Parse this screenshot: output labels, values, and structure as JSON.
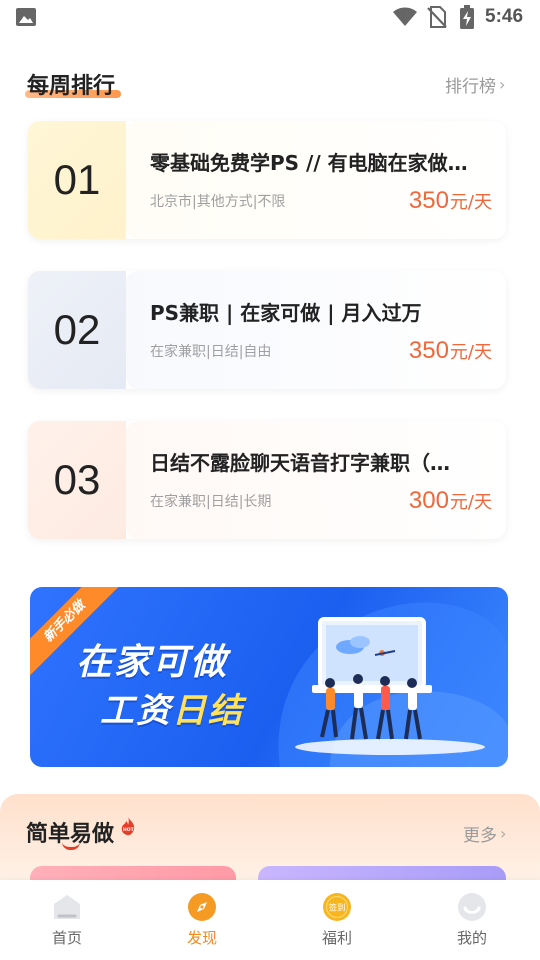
{
  "status_bar": {
    "time": "5:46",
    "icons": [
      "image-icon",
      "wifi-icon",
      "no-sim-icon",
      "battery-charging-icon"
    ]
  },
  "weekly_rank": {
    "title": "每周排行",
    "more_label": "排行榜",
    "items": [
      {
        "rank": "01",
        "title": "零基础免费学PS // 有电脑在家做…",
        "tags": "北京市|其他方式|不限",
        "salary": "350",
        "unit": "元/天"
      },
      {
        "rank": "02",
        "title": "PS兼职 | 在家可做 | 月入过万",
        "tags": "在家兼职|日结|自由",
        "salary": "350",
        "unit": "元/天"
      },
      {
        "rank": "03",
        "title": "日结不露脸聊天语音打字兼职（…",
        "tags": "在家兼职|日结|长期",
        "salary": "300",
        "unit": "元/天"
      }
    ]
  },
  "banner": {
    "ribbon": "新手必做",
    "line1": "在家可做",
    "line2_part1": "工资",
    "line2_accent": "日结"
  },
  "easy_section": {
    "title": "简单易做",
    "hot_badge": "HOT",
    "more_label": "更多"
  },
  "bottom_nav": {
    "items": [
      {
        "label": "首页",
        "icon": "home-icon",
        "active": false
      },
      {
        "label": "发现",
        "icon": "compass-icon",
        "active": true
      },
      {
        "label": "福利",
        "icon": "checkin-coin-icon",
        "badge": "签到",
        "active": false
      },
      {
        "label": "我的",
        "icon": "profile-icon",
        "active": false
      }
    ]
  },
  "colors": {
    "accent_orange": "#f0673a",
    "nav_active": "#f08a1c",
    "banner_blue": "#1b5ff0"
  }
}
